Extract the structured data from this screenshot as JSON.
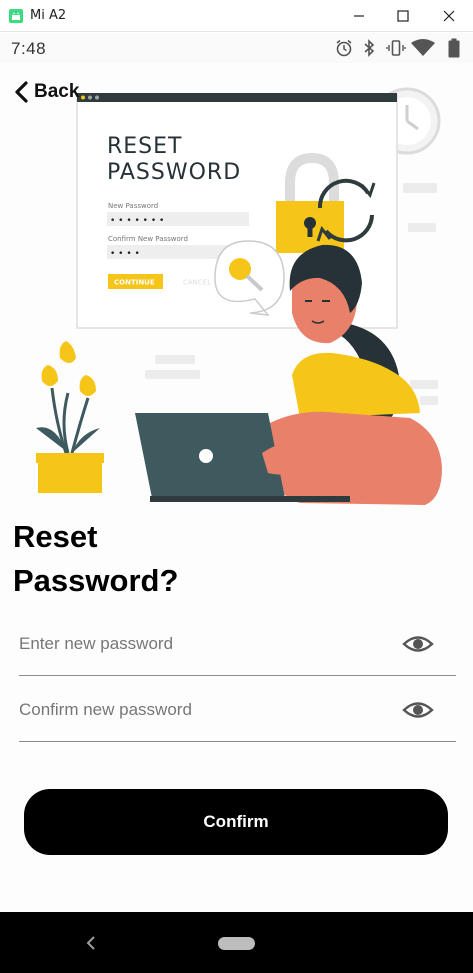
{
  "window": {
    "title": "Mi A2",
    "icons": [
      "android-app-icon",
      "minimize-icon",
      "maximize-icon",
      "close-icon"
    ]
  },
  "status_bar": {
    "time": "7:48",
    "icons": [
      "alarm-icon",
      "bluetooth-icon",
      "vibrate-icon",
      "wifi-icon",
      "battery-icon"
    ]
  },
  "header": {
    "back_label": "Back"
  },
  "illustration": {
    "card_title_line1": "RESET",
    "card_title_line2": "PASSWORD",
    "new_password_label": "New Password",
    "new_password_dots": "• • • • • • •",
    "confirm_password_label": "Confirm New Password",
    "confirm_password_dots": "• • • •",
    "continue_label": "CONTINUE",
    "cancel_label": "CANCEL"
  },
  "main": {
    "title_line1": "Reset",
    "title_line2": "Password?"
  },
  "form": {
    "new_password_placeholder": "Enter new password",
    "confirm_password_placeholder": "Confirm new password",
    "confirm_label": "Confirm"
  },
  "colors": {
    "accent_yellow": "#f5c518",
    "skin": "#e8806a",
    "laptop": "#3e5a5f",
    "button": "#000000"
  }
}
